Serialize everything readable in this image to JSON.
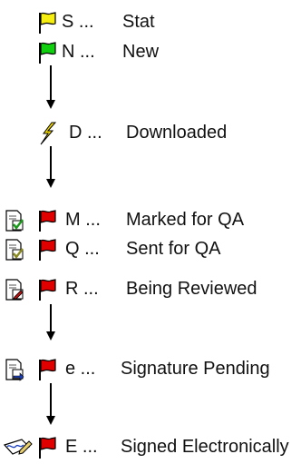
{
  "statuses": [
    {
      "code": "S ...",
      "label": "Stat",
      "icon": "yellow-flag-icon",
      "color": "#f2ea00"
    },
    {
      "code": "N ...",
      "label": "New",
      "icon": "green-flag-icon",
      "color": "#00c800"
    },
    {
      "code": "D ...",
      "label": "Downloaded",
      "icon": "lightning-bolt-icon",
      "color": "#f0d000"
    },
    {
      "code": "M ...",
      "label": "Marked for QA",
      "icon": "document-check-icon",
      "color": "#e00000"
    },
    {
      "code": "Q ...",
      "label": "Sent for QA",
      "icon": "document-check-icon",
      "color": "#e00000"
    },
    {
      "code": "R ...",
      "label": "Being Reviewed",
      "icon": "document-edit-icon",
      "color": "#e00000"
    },
    {
      "code": "e ...",
      "label": "Signature Pending",
      "icon": "document-arrow-icon",
      "color": "#e00000"
    },
    {
      "code": "E ...",
      "label": "Signed Electronically",
      "icon": "signed-pen-icon",
      "color": "#e00000"
    }
  ]
}
